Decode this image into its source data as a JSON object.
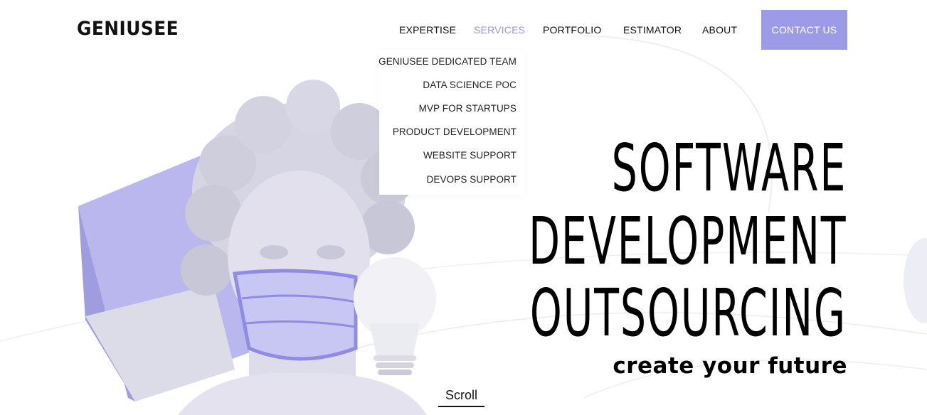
{
  "brand": {
    "logo_text": "GENIUSEE"
  },
  "nav": {
    "items": [
      {
        "label": "EXPERTISE",
        "active": false
      },
      {
        "label": "SERVICES",
        "active": true
      },
      {
        "label": "PORTFOLIO",
        "active": false
      },
      {
        "label": "ESTIMATOR",
        "active": false
      },
      {
        "label": "ABOUT",
        "active": false
      }
    ],
    "contact_label": "CONTACT US"
  },
  "services_menu": {
    "items": [
      "GENIUSEE DEDICATED TEAM",
      "DATA SCIENCE POC",
      "MVP FOR STARTUPS",
      "PRODUCT DEVELOPMENT",
      "WEBSITE SUPPORT",
      "DEVOPS SUPPORT"
    ]
  },
  "hero": {
    "headline_lines": [
      "SOFTWARE",
      "DEVELOPMENT",
      "OUTSOURCING"
    ],
    "tagline": "create your future",
    "scroll_label": "Scroll"
  },
  "colors": {
    "accent": "#9d9be8",
    "active_nav": "#9a98e0",
    "illustration": "#d9d8e8",
    "mask": "#a7a4ec"
  }
}
